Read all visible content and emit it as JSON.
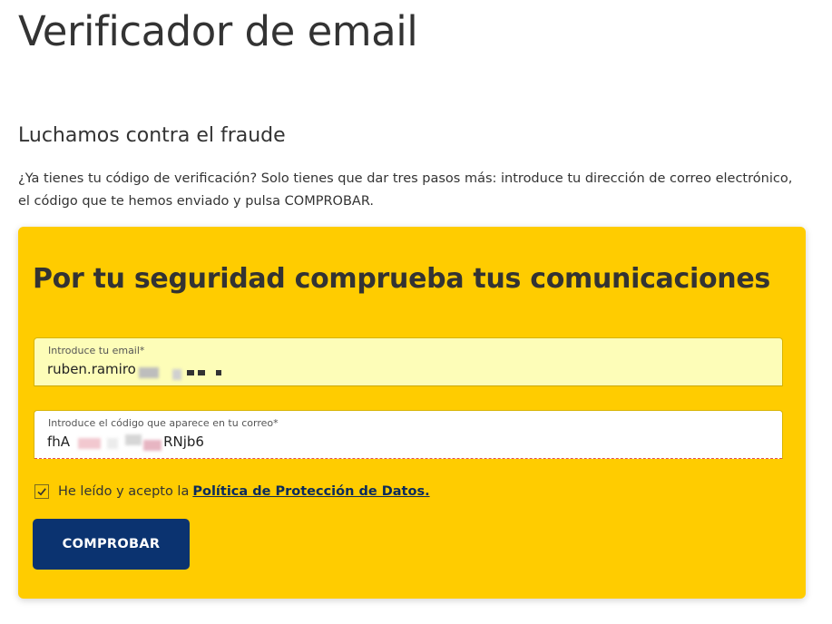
{
  "page": {
    "title": "Verificador de email",
    "section_title": "Luchamos contra el fraude",
    "intro": "¿Ya tienes tu código de verificación? Solo tienes que dar tres pasos más: introduce tu dirección de correo electrónico, el código que te hemos enviado y pulsa COMPROBAR."
  },
  "form": {
    "title": "Por tu seguridad comprueba tus comunicaciones",
    "email": {
      "label": "Introduce tu email*",
      "value": "ruben.ramiro"
    },
    "code": {
      "label": "Introduce el código que aparece en tu correo*",
      "value_prefix": "fhA",
      "value_suffix": "RNjb6"
    },
    "consent": {
      "checked": true,
      "text": "He leído y acepto la",
      "link": "Política de Protección de Datos."
    },
    "submit_label": "COMPROBAR"
  },
  "colors": {
    "card_bg": "#ffcc00",
    "button_bg": "#0b3370",
    "email_field_bg": "#fdfdb8",
    "link": "#0a2a5c"
  }
}
